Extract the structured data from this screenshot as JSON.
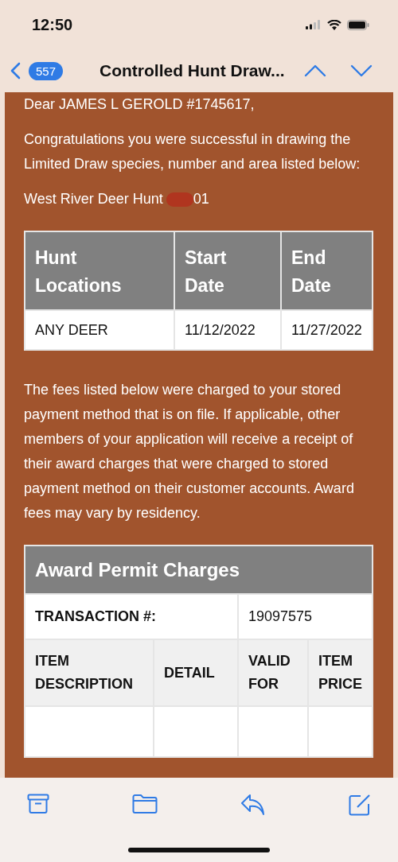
{
  "status_bar": {
    "time": "12:50"
  },
  "nav": {
    "unread_count": "557",
    "title": "Controlled Hunt Draw..."
  },
  "email": {
    "greeting": "Dear JAMES L GEROLD #1745617,",
    "intro": "Congratulations you were successful in drawing the Limited Draw species, number and area listed below:",
    "hunt_name": "West River Deer Hunt",
    "hunt_code_suffix": "01",
    "hunt_table": {
      "columns": [
        "Hunt Locations",
        "Start Date",
        "End Date"
      ],
      "rows": [
        [
          "ANY DEER",
          "11/12/2022",
          "11/27/2022"
        ]
      ]
    },
    "fees_note": "The fees listed below were charged to your stored payment method that is on file. If applicable, other members of your application will receive a receipt of their award charges that were charged to stored payment method on their customer accounts. Award fees may vary by residency.",
    "charges": {
      "title": "Award Permit Charges",
      "transaction_label": "TRANSACTION #:",
      "transaction_number": "19097575",
      "columns": [
        "ITEM DESCRIPTION",
        "DETAIL",
        "VALID FOR",
        "ITEM PRICE"
      ]
    }
  }
}
